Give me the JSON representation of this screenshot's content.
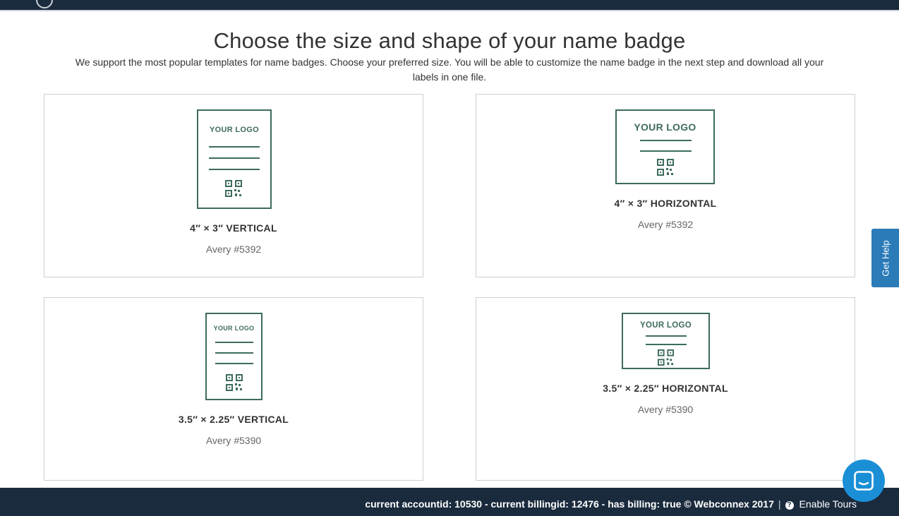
{
  "header": {
    "title": "Choose the size and shape of your name badge",
    "subtitle": "We support the most popular templates for name badges. Choose your preferred size. You will be able to customize the name badge in the next step and download all your labels in one file."
  },
  "badges": [
    {
      "logo_text": "YOUR LOGO",
      "name": "4″ × 3″ VERTICAL",
      "avery": "Avery #5392"
    },
    {
      "logo_text": "YOUR LOGO",
      "name": "4″ × 3″ HORIZONTAL",
      "avery": "Avery #5392"
    },
    {
      "logo_text": "YOUR LOGO",
      "name": "3.5″ × 2.25″ VERTICAL",
      "avery": "Avery #5390"
    },
    {
      "logo_text": "YOUR LOGO",
      "name": "3.5″ × 2.25″ HORIZONTAL",
      "avery": "Avery #5390"
    }
  ],
  "footer": {
    "info": "current accountid: 10530 - current billingid: 12476 - has billing: true © Webconnex 2017",
    "separator": "|",
    "help_icon": "?",
    "enable_tours": "Enable Tours"
  },
  "side_tab": {
    "label": "Get Help"
  },
  "icons": {
    "thumb": "qr-code-icon",
    "chat": "chat-bubble-icon",
    "footer": "question-circle-icon"
  },
  "colors": {
    "accent": "#3d6c5b",
    "navbar": "#1b2b3e",
    "help_tab": "#2a7bb8",
    "chat": "#1a8fd6"
  }
}
